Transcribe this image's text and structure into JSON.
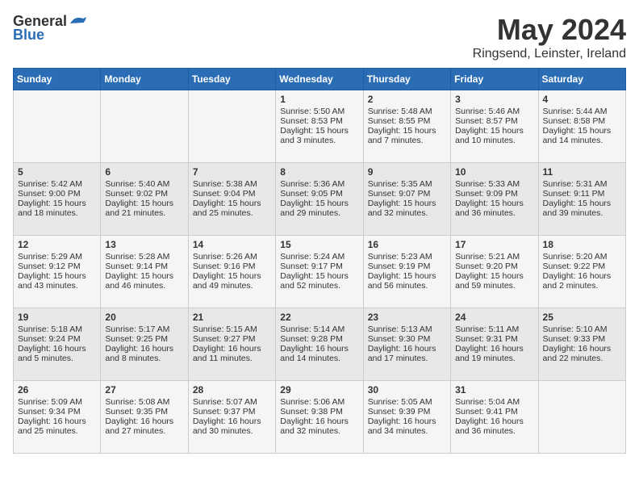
{
  "header": {
    "logo_general": "General",
    "logo_blue": "Blue",
    "month": "May 2024",
    "location": "Ringsend, Leinster, Ireland"
  },
  "weekdays": [
    "Sunday",
    "Monday",
    "Tuesday",
    "Wednesday",
    "Thursday",
    "Friday",
    "Saturday"
  ],
  "weeks": [
    {
      "cells": [
        {
          "day": "",
          "content": ""
        },
        {
          "day": "",
          "content": ""
        },
        {
          "day": "",
          "content": ""
        },
        {
          "day": "1",
          "content": "Sunrise: 5:50 AM\nSunset: 8:53 PM\nDaylight: 15 hours\nand 3 minutes."
        },
        {
          "day": "2",
          "content": "Sunrise: 5:48 AM\nSunset: 8:55 PM\nDaylight: 15 hours\nand 7 minutes."
        },
        {
          "day": "3",
          "content": "Sunrise: 5:46 AM\nSunset: 8:57 PM\nDaylight: 15 hours\nand 10 minutes."
        },
        {
          "day": "4",
          "content": "Sunrise: 5:44 AM\nSunset: 8:58 PM\nDaylight: 15 hours\nand 14 minutes."
        }
      ]
    },
    {
      "cells": [
        {
          "day": "5",
          "content": "Sunrise: 5:42 AM\nSunset: 9:00 PM\nDaylight: 15 hours\nand 18 minutes."
        },
        {
          "day": "6",
          "content": "Sunrise: 5:40 AM\nSunset: 9:02 PM\nDaylight: 15 hours\nand 21 minutes."
        },
        {
          "day": "7",
          "content": "Sunrise: 5:38 AM\nSunset: 9:04 PM\nDaylight: 15 hours\nand 25 minutes."
        },
        {
          "day": "8",
          "content": "Sunrise: 5:36 AM\nSunset: 9:05 PM\nDaylight: 15 hours\nand 29 minutes."
        },
        {
          "day": "9",
          "content": "Sunrise: 5:35 AM\nSunset: 9:07 PM\nDaylight: 15 hours\nand 32 minutes."
        },
        {
          "day": "10",
          "content": "Sunrise: 5:33 AM\nSunset: 9:09 PM\nDaylight: 15 hours\nand 36 minutes."
        },
        {
          "day": "11",
          "content": "Sunrise: 5:31 AM\nSunset: 9:11 PM\nDaylight: 15 hours\nand 39 minutes."
        }
      ]
    },
    {
      "cells": [
        {
          "day": "12",
          "content": "Sunrise: 5:29 AM\nSunset: 9:12 PM\nDaylight: 15 hours\nand 43 minutes."
        },
        {
          "day": "13",
          "content": "Sunrise: 5:28 AM\nSunset: 9:14 PM\nDaylight: 15 hours\nand 46 minutes."
        },
        {
          "day": "14",
          "content": "Sunrise: 5:26 AM\nSunset: 9:16 PM\nDaylight: 15 hours\nand 49 minutes."
        },
        {
          "day": "15",
          "content": "Sunrise: 5:24 AM\nSunset: 9:17 PM\nDaylight: 15 hours\nand 52 minutes."
        },
        {
          "day": "16",
          "content": "Sunrise: 5:23 AM\nSunset: 9:19 PM\nDaylight: 15 hours\nand 56 minutes."
        },
        {
          "day": "17",
          "content": "Sunrise: 5:21 AM\nSunset: 9:20 PM\nDaylight: 15 hours\nand 59 minutes."
        },
        {
          "day": "18",
          "content": "Sunrise: 5:20 AM\nSunset: 9:22 PM\nDaylight: 16 hours\nand 2 minutes."
        }
      ]
    },
    {
      "cells": [
        {
          "day": "19",
          "content": "Sunrise: 5:18 AM\nSunset: 9:24 PM\nDaylight: 16 hours\nand 5 minutes."
        },
        {
          "day": "20",
          "content": "Sunrise: 5:17 AM\nSunset: 9:25 PM\nDaylight: 16 hours\nand 8 minutes."
        },
        {
          "day": "21",
          "content": "Sunrise: 5:15 AM\nSunset: 9:27 PM\nDaylight: 16 hours\nand 11 minutes."
        },
        {
          "day": "22",
          "content": "Sunrise: 5:14 AM\nSunset: 9:28 PM\nDaylight: 16 hours\nand 14 minutes."
        },
        {
          "day": "23",
          "content": "Sunrise: 5:13 AM\nSunset: 9:30 PM\nDaylight: 16 hours\nand 17 minutes."
        },
        {
          "day": "24",
          "content": "Sunrise: 5:11 AM\nSunset: 9:31 PM\nDaylight: 16 hours\nand 19 minutes."
        },
        {
          "day": "25",
          "content": "Sunrise: 5:10 AM\nSunset: 9:33 PM\nDaylight: 16 hours\nand 22 minutes."
        }
      ]
    },
    {
      "cells": [
        {
          "day": "26",
          "content": "Sunrise: 5:09 AM\nSunset: 9:34 PM\nDaylight: 16 hours\nand 25 minutes."
        },
        {
          "day": "27",
          "content": "Sunrise: 5:08 AM\nSunset: 9:35 PM\nDaylight: 16 hours\nand 27 minutes."
        },
        {
          "day": "28",
          "content": "Sunrise: 5:07 AM\nSunset: 9:37 PM\nDaylight: 16 hours\nand 30 minutes."
        },
        {
          "day": "29",
          "content": "Sunrise: 5:06 AM\nSunset: 9:38 PM\nDaylight: 16 hours\nand 32 minutes."
        },
        {
          "day": "30",
          "content": "Sunrise: 5:05 AM\nSunset: 9:39 PM\nDaylight: 16 hours\nand 34 minutes."
        },
        {
          "day": "31",
          "content": "Sunrise: 5:04 AM\nSunset: 9:41 PM\nDaylight: 16 hours\nand 36 minutes."
        },
        {
          "day": "",
          "content": ""
        }
      ]
    }
  ]
}
